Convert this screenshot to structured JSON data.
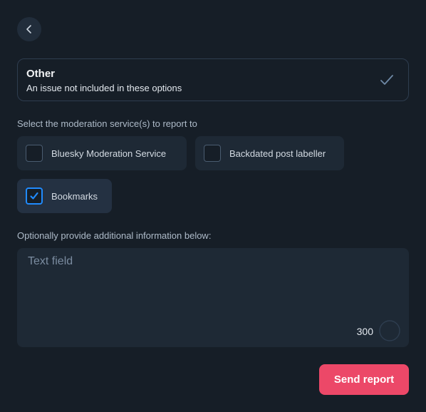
{
  "header": {
    "back_icon": "chevron-left-icon"
  },
  "reason": {
    "title": "Other",
    "description": "An issue not included in these options",
    "check_icon": "check-icon"
  },
  "services": {
    "label": "Select the moderation service(s) to report to",
    "items": [
      {
        "label": "Bluesky Moderation Service",
        "checked": false
      },
      {
        "label": "Backdated post labeller",
        "checked": false
      },
      {
        "label": "Bookmarks",
        "checked": true
      }
    ]
  },
  "details": {
    "label": "Optionally provide additional information below:",
    "placeholder": "Text field",
    "value": "",
    "char_limit": "300"
  },
  "actions": {
    "send_label": "Send report"
  },
  "colors": {
    "background": "#161e27",
    "card": "#1e2935",
    "accent_blue": "#208bfe",
    "send_button": "#ec4868"
  }
}
